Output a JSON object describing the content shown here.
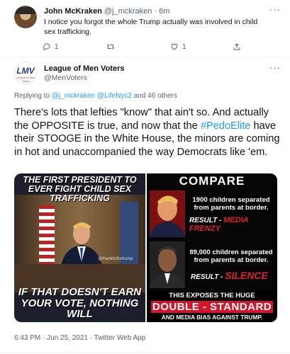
{
  "reply": {
    "name": "John McKraken",
    "handle_time": "@j_mckraken · 6m",
    "text": "I notice you forgot the whole Trump actually was involved in child sex trafficking.",
    "reply_count": "1",
    "like_count": "1",
    "more": "···"
  },
  "tweet": {
    "avatar_text": "LMV",
    "avatar_subtext": "League of Men Voters",
    "name": "League of Men Voters",
    "handle": "@MenVoters",
    "more": "···",
    "replying_prefix": "Replying to ",
    "replying_mentions": "@j_mckraken @LifeNyc2",
    "replying_suffix": " and 46 others",
    "body_part1": "There's lots that lefties \"know\" that ain't so.  And actually the OPPOSITE is true, and now that the ",
    "hashtag": "#PedoElite",
    "body_part2": " have their STOOGE in the White House, the minors are coming in hot and unaccompanied the way Democrats like 'em.",
    "timestamp": "6:43 PM · Jun 25, 2021 · Twitter Web App"
  },
  "image_left": {
    "caption_top": "THE FIRST PRESIDENT TO EVER FIGHT CHILD SEX TRAFFICKING",
    "caption_bottom": "IF THAT DOESN'T EARN YOUR VOTE, NOTHING WILL",
    "watermark": "@thankfulfortrump"
  },
  "image_right": {
    "heading": "COMPARE",
    "text1": "1900 children separated from parents at border.",
    "result_label1": "RESULT - ",
    "result_value1": "MEDIA FRENZY",
    "text2": "89,000 children separated from parents at border.",
    "result_label2": "RESULT - ",
    "result_value2": "SILENCE",
    "exposes": "THIS EXPOSES THE HUGE",
    "double": "DOUBLE - STANDARD",
    "media_bias": "AND MEDIA BIAS AGAINST TRUMP."
  },
  "colors": {
    "link": "#1d9bf0",
    "muted": "#536471",
    "red": "#d3142a"
  }
}
